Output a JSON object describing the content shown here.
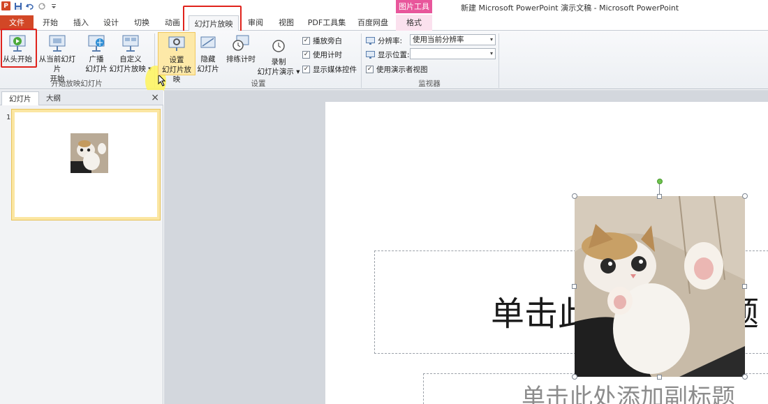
{
  "window": {
    "title": "新建 Microsoft PowerPoint 演示文稿 - Microsoft PowerPoint",
    "context_tool_label": "图片工具",
    "app_badge": "P"
  },
  "tabs": [
    {
      "label": "文件"
    },
    {
      "label": "开始"
    },
    {
      "label": "插入"
    },
    {
      "label": "设计"
    },
    {
      "label": "切换"
    },
    {
      "label": "动画"
    },
    {
      "label": "幻灯片放映"
    },
    {
      "label": "审阅"
    },
    {
      "label": "视图"
    },
    {
      "label": "PDF工具集"
    },
    {
      "label": "百度网盘"
    },
    {
      "label": "格式"
    }
  ],
  "ribbon": {
    "group_start": {
      "label": "开始放映幻灯片",
      "from_beginning": "从头开始",
      "from_current_1": "从当前幻灯片",
      "from_current_2": "开始",
      "broadcast_1": "广播",
      "broadcast_2": "幻灯片",
      "custom_1": "自定义",
      "custom_2": "幻灯片放映"
    },
    "group_setup": {
      "label": "设置",
      "setup_1": "设置",
      "setup_2": "幻灯片放映",
      "hide_1": "隐藏",
      "hide_2": "幻灯片",
      "rehearse": "排练计时",
      "record_1": "录制",
      "record_2": "幻灯片演示",
      "chk_narration": "播放旁白",
      "chk_timings": "使用计时",
      "chk_media": "显示媒体控件"
    },
    "group_monitors": {
      "label": "监视器",
      "resolution_label": "分辨率:",
      "resolution_value": "使用当前分辨率",
      "show_on_label": "显示位置:",
      "show_on_value": "",
      "presenter_view": "使用演示者视图"
    }
  },
  "pane": {
    "tab_slides": "幻灯片",
    "tab_outline": "大纲",
    "close": "×",
    "slide_number": "1"
  },
  "slide": {
    "title_placeholder": "单击此处添加标题",
    "subtitle_placeholder": "单击此处添加副标题"
  },
  "colors": {
    "file_tab": "#d24726",
    "picture_tools": "#e8569b",
    "highlight_box": "#e0231c"
  }
}
